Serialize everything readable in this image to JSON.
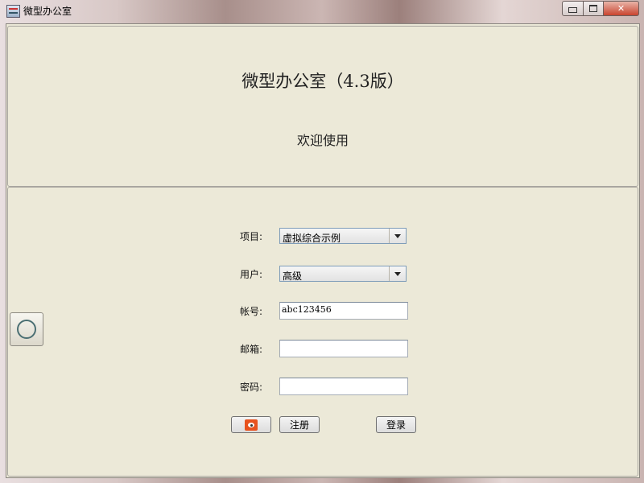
{
  "window": {
    "title": "微型办公室"
  },
  "header": {
    "app_title": "微型办公室（4.3版）",
    "welcome": "欢迎使用"
  },
  "form": {
    "project_label": "项目:",
    "project_value": "虚拟综合示例",
    "user_label": "用户:",
    "user_value": "高级",
    "account_label": "帐号:",
    "account_value": "abc123456",
    "email_label": "邮箱:",
    "email_value": "",
    "password_label": "密码:",
    "password_value": ""
  },
  "buttons": {
    "register": "注册",
    "login": "登录"
  },
  "icons": {
    "app": "app-icon",
    "side": "circle-icon",
    "weibo": "weibo-icon",
    "dropdown": "chevron-down-icon"
  }
}
